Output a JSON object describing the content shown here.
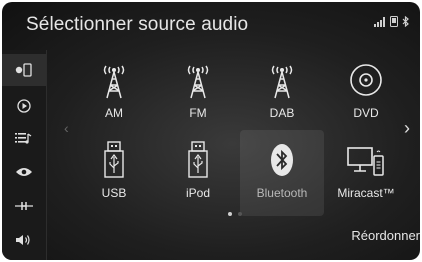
{
  "header": {
    "title": "Sélectionner source audio",
    "status_icons": [
      "signal-icon",
      "phone-icon",
      "bluetooth-icon"
    ]
  },
  "sidebar": {
    "items": [
      {
        "icon": "phone-media-icon",
        "active": true
      },
      {
        "icon": "play-circle-icon",
        "active": false
      },
      {
        "icon": "playlist-icon",
        "active": false
      },
      {
        "icon": "eye-icon",
        "active": false
      },
      {
        "icon": "tuning-icon",
        "active": false
      },
      {
        "icon": "volume-icon",
        "active": false
      }
    ]
  },
  "sources": [
    {
      "label": "AM",
      "icon": "radio-tower-icon"
    },
    {
      "label": "FM",
      "icon": "radio-tower-icon"
    },
    {
      "label": "DAB",
      "icon": "radio-tower-icon"
    },
    {
      "label": "DVD",
      "icon": "disc-icon"
    },
    {
      "label": "USB",
      "icon": "usb-icon"
    },
    {
      "label": "iPod",
      "icon": "usb-icon"
    },
    {
      "label": "Bluetooth",
      "icon": "bluetooth-icon",
      "selected": true
    },
    {
      "label": "Miracast™",
      "icon": "miracast-icon"
    }
  ],
  "pager": {
    "current": 1,
    "total": 2
  },
  "footer": {
    "reorder_label": "Réordonner"
  }
}
